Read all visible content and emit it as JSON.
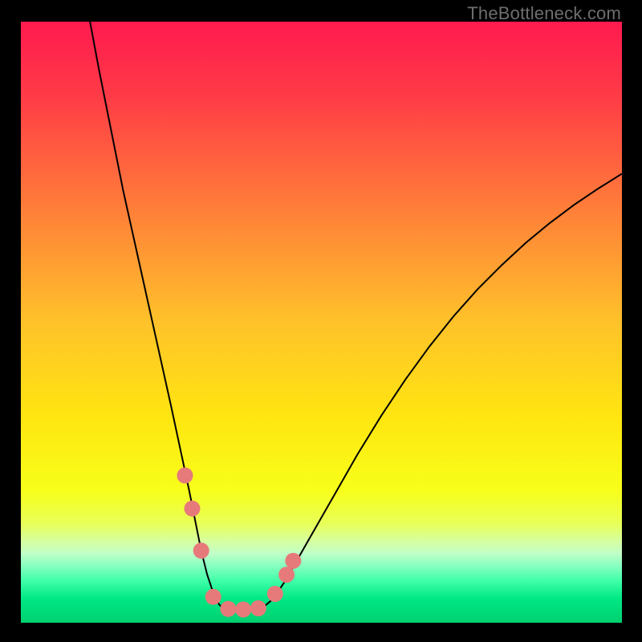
{
  "watermark": "TheBottleneck.com",
  "chart_data": {
    "type": "line",
    "title": "",
    "xlabel": "",
    "ylabel": "",
    "xlim": [
      0,
      100
    ],
    "ylim": [
      0,
      100
    ],
    "background_gradient": {
      "stops": [
        {
          "offset": 0.0,
          "color": "#ff1a4f"
        },
        {
          "offset": 0.12,
          "color": "#ff3a47"
        },
        {
          "offset": 0.3,
          "color": "#ff7a3a"
        },
        {
          "offset": 0.5,
          "color": "#ffc22a"
        },
        {
          "offset": 0.66,
          "color": "#ffe610"
        },
        {
          "offset": 0.78,
          "color": "#f7ff1a"
        },
        {
          "offset": 0.835,
          "color": "#e8ff58"
        },
        {
          "offset": 0.865,
          "color": "#d6ffa2"
        },
        {
          "offset": 0.885,
          "color": "#c0ffc8"
        },
        {
          "offset": 0.905,
          "color": "#88ffc0"
        },
        {
          "offset": 0.93,
          "color": "#40ffa8"
        },
        {
          "offset": 0.96,
          "color": "#00e884"
        },
        {
          "offset": 1.0,
          "color": "#00d070"
        }
      ]
    },
    "series": [
      {
        "name": "bottleneck-curve",
        "color": "#000000",
        "stroke_width": 2,
        "x": [
          11.5,
          13,
          15,
          17,
          19,
          21,
          23,
          25,
          26.5,
          28,
          29,
          30,
          31,
          32,
          33,
          34,
          36,
          38,
          40,
          42,
          44,
          48,
          52,
          56,
          60,
          64,
          68,
          72,
          76,
          80,
          84,
          88,
          92,
          96,
          100
        ],
        "y": [
          100,
          92,
          82,
          72,
          63,
          54,
          45,
          36,
          29,
          22,
          17,
          12,
          8,
          5,
          3,
          2.2,
          2,
          2,
          2.3,
          4,
          7,
          14,
          21,
          28,
          34.5,
          40.5,
          46,
          51,
          55.5,
          59.5,
          63.2,
          66.5,
          69.5,
          72.2,
          74.7
        ]
      }
    ],
    "markers": [
      {
        "name": "salmon-dots",
        "color": "#e67a7a",
        "radius": 10,
        "points": [
          {
            "x": 27.3,
            "y": 24.5
          },
          {
            "x": 28.5,
            "y": 19.0
          },
          {
            "x": 30.0,
            "y": 12.0
          },
          {
            "x": 32.0,
            "y": 4.3
          },
          {
            "x": 34.5,
            "y": 2.3
          },
          {
            "x": 37.0,
            "y": 2.2
          },
          {
            "x": 39.5,
            "y": 2.4
          },
          {
            "x": 42.3,
            "y": 4.8
          },
          {
            "x": 44.2,
            "y": 8.0
          },
          {
            "x": 45.3,
            "y": 10.3
          }
        ]
      }
    ]
  }
}
